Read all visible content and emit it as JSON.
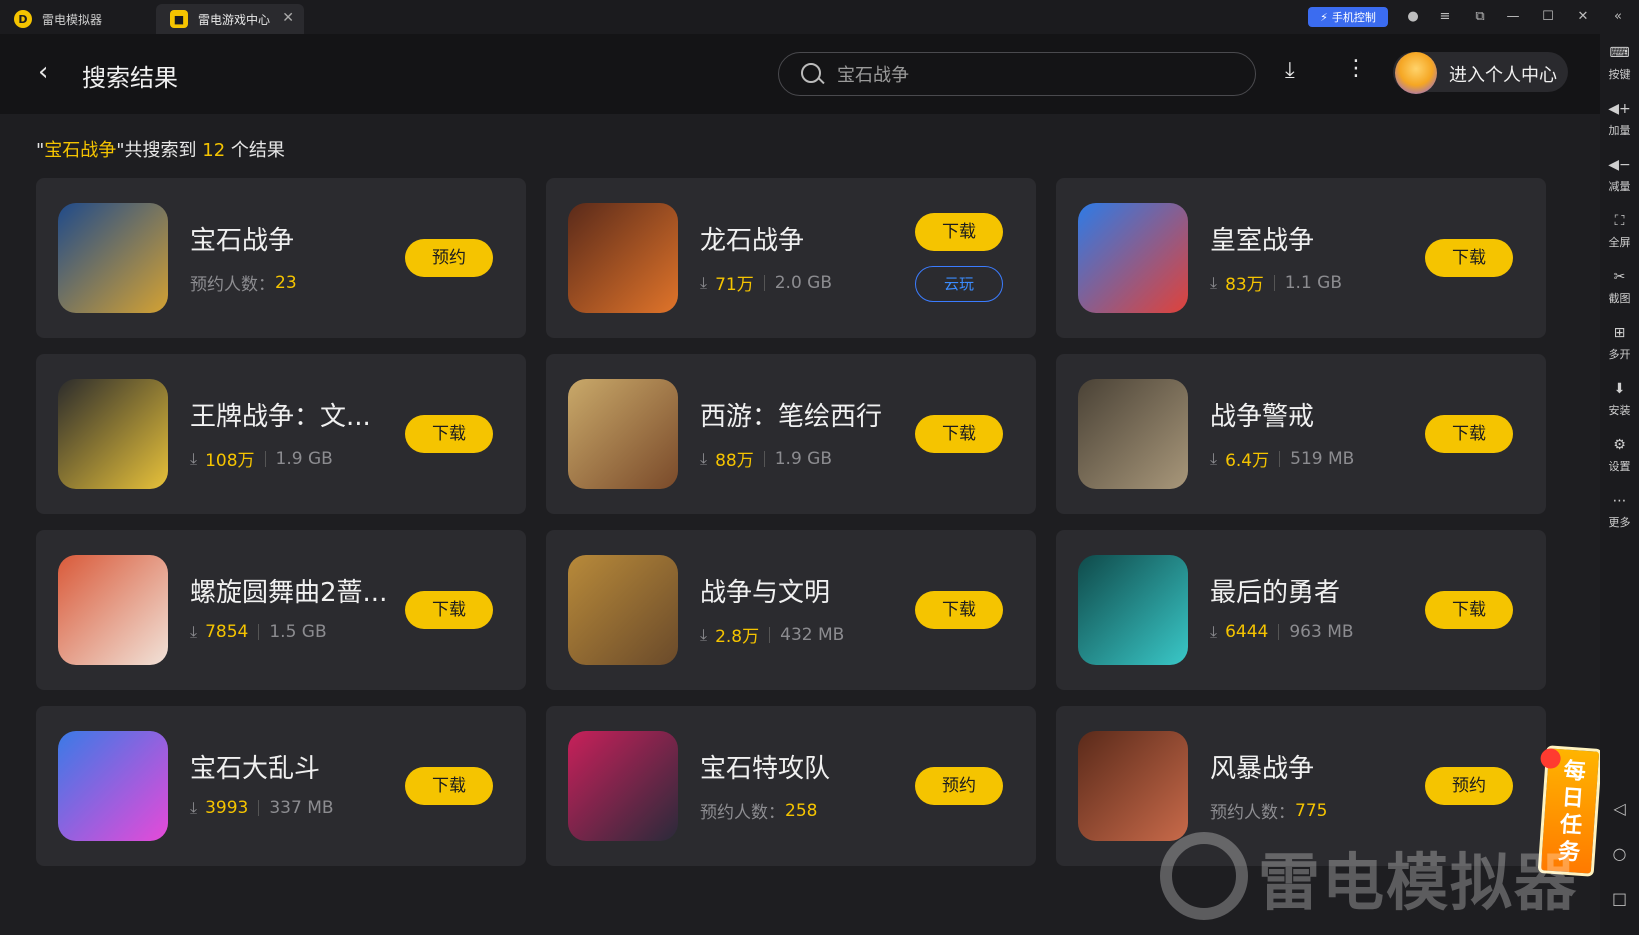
{
  "titlebar": {
    "tabs": [
      {
        "label": "雷电模拟器"
      },
      {
        "label": "雷电游戏中心"
      }
    ],
    "phone_control": "手机控制"
  },
  "sidebar": {
    "items": [
      {
        "icon": "keyboard-icon",
        "label": "按键"
      },
      {
        "icon": "volume-up-icon",
        "label": "加量"
      },
      {
        "icon": "volume-down-icon",
        "label": "减量"
      },
      {
        "icon": "fullscreen-icon",
        "label": "全屏"
      },
      {
        "icon": "screenshot-icon",
        "label": "截图"
      },
      {
        "icon": "multi-instance-icon",
        "label": "多开"
      },
      {
        "icon": "apk-install-icon",
        "label": "安装"
      },
      {
        "icon": "settings-icon",
        "label": "设置"
      },
      {
        "icon": "more-icon",
        "label": "更多"
      }
    ]
  },
  "header": {
    "title": "搜索结果",
    "search_value": "宝石战争",
    "profile_label": "进入个人中心"
  },
  "summary": {
    "quote_open": "\"",
    "keyword": "宝石战争",
    "middle": "\"共搜索到 ",
    "count": "12",
    "suffix": " 个结果"
  },
  "games": [
    {
      "name": "宝石战争",
      "type": "reserve",
      "reserve_label": "预约人数：",
      "reserve_count": "23",
      "button": "预约",
      "icon_colors": [
        "#1f4a8a",
        "#d4a233"
      ]
    },
    {
      "name": "龙石战争",
      "type": "download",
      "downloads": "71万",
      "size": "2.0 GB",
      "button": "下载",
      "cloud": "云玩",
      "icon_colors": [
        "#5a2a1a",
        "#e0742a"
      ]
    },
    {
      "name": "皇室战争",
      "type": "download",
      "downloads": "83万",
      "size": "1.1 GB",
      "button": "下载",
      "icon_colors": [
        "#2e7be6",
        "#e0423a"
      ]
    },
    {
      "name": "王牌战争：文...",
      "type": "download",
      "downloads": "108万",
      "size": "1.9 GB",
      "button": "下载",
      "icon_colors": [
        "#2c2c2c",
        "#e8c23a"
      ]
    },
    {
      "name": "西游：笔绘西行",
      "type": "download",
      "downloads": "88万",
      "size": "1.9 GB",
      "button": "下载",
      "icon_colors": [
        "#c9a96a",
        "#7a4a2a"
      ]
    },
    {
      "name": "战争警戒",
      "type": "download",
      "downloads": "6.4万",
      "size": "519 MB",
      "button": "下载",
      "icon_colors": [
        "#4a4236",
        "#a8977a"
      ]
    },
    {
      "name": "螺旋圆舞曲2蔷...",
      "type": "download",
      "downloads": "7854",
      "size": "1.5 GB",
      "button": "下载",
      "icon_colors": [
        "#d95a3a",
        "#f1e2d8"
      ]
    },
    {
      "name": "战争与文明",
      "type": "download",
      "downloads": "2.8万",
      "size": "432 MB",
      "button": "下载",
      "icon_colors": [
        "#b88a3a",
        "#6a4a2a"
      ]
    },
    {
      "name": "最后的勇者",
      "type": "download",
      "downloads": "6444",
      "size": "963 MB",
      "button": "下载",
      "icon_colors": [
        "#0f4a4a",
        "#3ac8c8"
      ]
    },
    {
      "name": "宝石大乱斗",
      "type": "download",
      "downloads": "3993",
      "size": "337 MB",
      "button": "下载",
      "icon_colors": [
        "#3a7ae6",
        "#e64ad8"
      ]
    },
    {
      "name": "宝石特攻队",
      "type": "reserve",
      "reserve_label": "预约人数：",
      "reserve_count": "258",
      "button": "预约",
      "icon_colors": [
        "#c8205a",
        "#2a2a3a"
      ]
    },
    {
      "name": "风暴战争",
      "type": "reserve",
      "reserve_label": "预约人数：",
      "reserve_count": "775",
      "button": "预约",
      "icon_colors": [
        "#5a2a1a",
        "#c86a4a"
      ]
    }
  ],
  "daily_task": {
    "label": "每日任务"
  },
  "watermark": {
    "label": "雷电模拟器"
  },
  "colors": {
    "accent": "#f5c400",
    "card": "#2b2b2f",
    "background": "#1e1e21",
    "cloud": "#3b7cff"
  }
}
